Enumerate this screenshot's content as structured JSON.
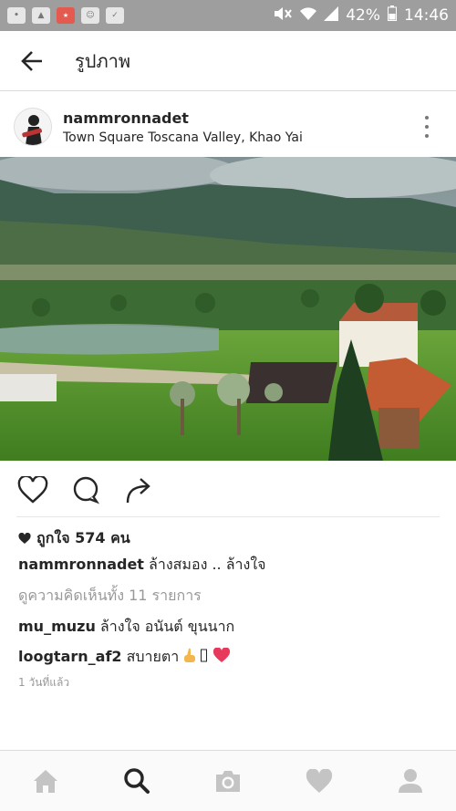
{
  "status_bar": {
    "battery": "42%",
    "time": "14:46",
    "icons": [
      "line-app-icon",
      "gallery-icon",
      "star-app-icon",
      "ghost-app-icon",
      "task-icon",
      "mute-icon",
      "wifi-icon",
      "signal-icon",
      "battery-icon"
    ]
  },
  "app_bar": {
    "title": "รูปภาพ"
  },
  "post": {
    "username": "nammronnadet",
    "location": "Town Square Toscana Valley, Khao Yai",
    "likes_text": "ถูกใจ 574 คน",
    "caption_user": "nammronnadet",
    "caption_text": " ล้างสมอง .. ล้างใจ",
    "view_all_comments": "ดูความคิดเห็นทั้ง 11 รายการ",
    "comments": [
      {
        "user": "mu_muzu",
        "text": " ล้างใจ อนันต์ ขุนนาก"
      },
      {
        "user": "loogtarn_af2",
        "text": " สบายตา "
      }
    ],
    "timestamp": "1 วันที่แล้ว"
  },
  "colors": {
    "status_bar_bg": "#9e9e9e",
    "text_primary": "#262626",
    "text_secondary": "#999999",
    "heart_emoji": "#e8395c"
  },
  "tab_bar": {
    "tabs": [
      "home-icon",
      "search-icon",
      "camera-icon",
      "heart-icon",
      "profile-icon"
    ],
    "active": "search-icon"
  }
}
